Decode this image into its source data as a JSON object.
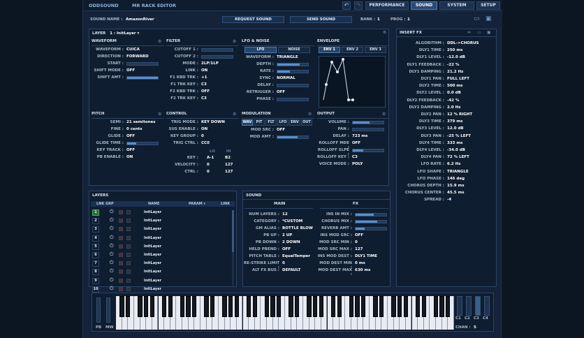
{
  "topbar": {
    "brand": "ODDSOUND",
    "editor": "MR RACK EDITOR",
    "undo_icon": "undo-icon",
    "redo_icon": "redo-icon",
    "nav": [
      "PERFORMANCE",
      "SOUND",
      "SYSTEM",
      "SETUP"
    ],
    "active_nav": "SOUND"
  },
  "sound_bar": {
    "sound_name_label": "SOUND NAME :",
    "sound_name": "AmazonRiver",
    "request_label": "REQUEST SOUND",
    "send_label": "SEND SOUND",
    "bank_label": "BANK :",
    "bank": "1",
    "prog_label": "PROG :",
    "prog": "1"
  },
  "layer": {
    "title": "LAYER",
    "selected": "1 : InitLayer ▾"
  },
  "waveform": {
    "title": "WAVEFORM",
    "rows": [
      {
        "label": "WAVEFORM :",
        "value": "CUICA"
      },
      {
        "label": "DIRECTION :",
        "value": "FORWARD"
      },
      {
        "label": "START :",
        "value": ""
      },
      {
        "label": "SHIFT MODE :",
        "value": "OFF"
      },
      {
        "label": "SHIFT AMT :",
        "value": ""
      }
    ]
  },
  "filter": {
    "title": "FILTER",
    "rows": [
      {
        "label": "CUTOFF 1 :",
        "value": ""
      },
      {
        "label": "CUTOFF 2 :",
        "value": ""
      },
      {
        "label": "MODE :",
        "value": "2LP/1LP"
      },
      {
        "label": "LINK :",
        "value": "ON"
      },
      {
        "label": "F1 KBD TRK :",
        "value": "+1"
      },
      {
        "label": "F1 TRK KEY :",
        "value": "C3"
      },
      {
        "label": "F2 KBD TRK :",
        "value": "OFF"
      },
      {
        "label": "F2 TRK KEY :",
        "value": "C3"
      }
    ]
  },
  "lfo_noise": {
    "title": "LFO & NOISE",
    "tabs": [
      "LFO",
      "NOISE"
    ],
    "rows": [
      {
        "label": "WAVEFORM :",
        "value": "TRIANGLE"
      },
      {
        "label": "DEPTH :",
        "value": ""
      },
      {
        "label": "RATE :",
        "value": ""
      },
      {
        "label": "SYNC :",
        "value": "NORMAL"
      },
      {
        "label": "DELAY :",
        "value": ""
      },
      {
        "label": "RETRIGGER :",
        "value": "OFF"
      },
      {
        "label": "PHASE :",
        "value": ""
      }
    ]
  },
  "envelope": {
    "title": "ENVELOPE",
    "tabs": [
      "ENV 1",
      "ENV 2",
      "ENV 3"
    ]
  },
  "pitch": {
    "title": "PITCH",
    "rows": [
      {
        "label": "SEMI :",
        "value": "21 semitones"
      },
      {
        "label": "FINE :",
        "value": "0 cents"
      },
      {
        "label": "GLIDE :",
        "value": "OFF"
      },
      {
        "label": "GLIDE TIME :",
        "value": ""
      },
      {
        "label": "KEY TRACK :",
        "value": "OFF"
      },
      {
        "label": "PB ENABLE :",
        "value": "ON"
      }
    ]
  },
  "control": {
    "title": "CONTROL",
    "rows": [
      {
        "label": "TRIG MODE :",
        "value": "KEY DOWN"
      },
      {
        "label": "SUS ENABLE :",
        "value": "ON"
      },
      {
        "label": "KEY GROUP :",
        "value": "0"
      },
      {
        "label": "TRIG CTRL :",
        "value": "CC0"
      }
    ],
    "lo_label": "LO",
    "hi_label": "HI",
    "range_rows": [
      {
        "label": "KEY :",
        "lo": "A-1",
        "hi": "B2"
      },
      {
        "label": "VELOCITY :",
        "lo": "0",
        "hi": "127"
      },
      {
        "label": "CTRL :",
        "lo": "0",
        "hi": "127"
      }
    ]
  },
  "modulation": {
    "title": "MODULATION",
    "tabs": [
      "WAV",
      "PIT",
      "FLT",
      "LFO",
      "ENV",
      "OUT"
    ],
    "rows": [
      {
        "label": "MOD SRC :",
        "value": "OFF"
      },
      {
        "label": "MOD AMT :",
        "value": ""
      }
    ]
  },
  "output": {
    "title": "OUTPUT",
    "rows": [
      {
        "label": "VOLUME :",
        "value": ""
      },
      {
        "label": "PAN :",
        "value": ""
      },
      {
        "label": "DELAY :",
        "value": "723 ms"
      },
      {
        "label": "ROLLOFF MDE :",
        "value": "OFF"
      },
      {
        "label": "ROLLOFF SLPE :",
        "value": ""
      },
      {
        "label": "ROLLOFF KEY :",
        "value": "C3"
      },
      {
        "label": "VOICE MODE :",
        "value": "POLY"
      }
    ]
  },
  "insert_fx": {
    "title": "INSERT FX",
    "rows": [
      {
        "label": "ALGORITHM :",
        "value": "DDL->CHORUS"
      },
      {
        "label": "DLY1 TIME :",
        "value": "250 ms"
      },
      {
        "label": "DLY1 LEVEL :",
        "value": "-12.0 dB"
      },
      {
        "label": "DLY1 FEEDBACK :",
        "value": "-22 %"
      },
      {
        "label": "DLY1 DAMPING :",
        "value": "21.2 Hz"
      },
      {
        "label": "DLY1 PAN :",
        "value": "FULL LEFT"
      },
      {
        "label": "DLY2 TIME :",
        "value": "500 ms"
      },
      {
        "label": "DLY2 LEVEL :",
        "value": "0.0 dB"
      },
      {
        "label": "DLY2 FEEDBACK :",
        "value": "-42 %"
      },
      {
        "label": "DLY2 DAMPING :",
        "value": "2.0 Hz"
      },
      {
        "label": "DLY2 PAN :",
        "value": "12 % RIGHT"
      },
      {
        "label": "DLY3 TIME :",
        "value": "379 ms"
      },
      {
        "label": "DLY3 LEVEL :",
        "value": "12.0 dB"
      },
      {
        "label": "DLY3 PAN :",
        "value": "-25 % LEFT"
      },
      {
        "label": "DLY4 TIME :",
        "value": "333 ms"
      },
      {
        "label": "DLY4 LEVEL :",
        "value": "-34.0 dB"
      },
      {
        "label": "DLY4 PAN :",
        "value": "72 % LEFT"
      },
      {
        "label": "LFO RATE :",
        "value": "6.2 Hz"
      },
      {
        "label": "LFO SHAPE :",
        "value": "TRIANGLE"
      },
      {
        "label": "LFO PHASE :",
        "value": "146 deg"
      },
      {
        "label": "CHORUS DEPTH :",
        "value": "15.9 ms"
      },
      {
        "label": "CHORUS CENTER :",
        "value": "45.5 ms"
      },
      {
        "label": "SPREAD :",
        "value": "-4"
      }
    ]
  },
  "layers": {
    "title": "LAYERS",
    "headers": [
      "LNK GRP",
      "NAME",
      "PARAM ▾",
      "LINK"
    ],
    "rows": [
      {
        "num": "1",
        "name": "InitLayer"
      },
      {
        "num": "2",
        "name": "InitLayer"
      },
      {
        "num": "3",
        "name": "InitLayer"
      },
      {
        "num": "4",
        "name": "InitLayer"
      },
      {
        "num": "5",
        "name": "InitLayer"
      },
      {
        "num": "6",
        "name": "InitLayer"
      },
      {
        "num": "7",
        "name": "InitLayer"
      },
      {
        "num": "8",
        "name": "InitLayer"
      },
      {
        "num": "9",
        "name": "InitLayer"
      },
      {
        "num": "10",
        "name": "InitLayer"
      }
    ]
  },
  "sound": {
    "title": "SOUND",
    "main_header": "MAIN",
    "fx_header": "FX",
    "main_rows": [
      {
        "label": "NUM LAYERS :",
        "value": "12"
      },
      {
        "label": "CATEGORY :",
        "value": "*CUSTOM"
      },
      {
        "label": "GM ALIAS :",
        "value": "BOTTLE BLOW"
      },
      {
        "label": "PB UP :",
        "value": "2 UP"
      },
      {
        "label": "PB DOWN :",
        "value": "2 DOWN"
      },
      {
        "label": "HELD PBEND :",
        "value": "OFF"
      },
      {
        "label": "PITCH TABLE :",
        "value": "EqualTemper"
      },
      {
        "label": "RE-STRIKE LIMIT :",
        "value": "0"
      },
      {
        "label": "ALT FX BUS :",
        "value": "DEFAULT"
      }
    ],
    "fx_rows": [
      {
        "label": "INS IN MIX :",
        "value": ""
      },
      {
        "label": "CHORUS MIX :",
        "value": ""
      },
      {
        "label": "REVERB AMT :",
        "value": ""
      },
      {
        "label": "INS MOD SRC :",
        "value": "OFF"
      },
      {
        "label": "MOD SRC MIN :",
        "value": "0"
      },
      {
        "label": "MOD SRC MAX :",
        "value": "127"
      },
      {
        "label": "INS MOD DEST :",
        "value": "DLY1 TIME"
      },
      {
        "label": "MOD DEST MIN :",
        "value": "0 ms"
      },
      {
        "label": "MOD DEST MAX :",
        "value": "630 ms"
      }
    ]
  },
  "keyboard": {
    "pb_label": "PB",
    "mw_label": "MW",
    "octaves": [
      "C1",
      "C2",
      "C3",
      "C4"
    ],
    "chan_label": "CHAN :",
    "chan": "5"
  }
}
